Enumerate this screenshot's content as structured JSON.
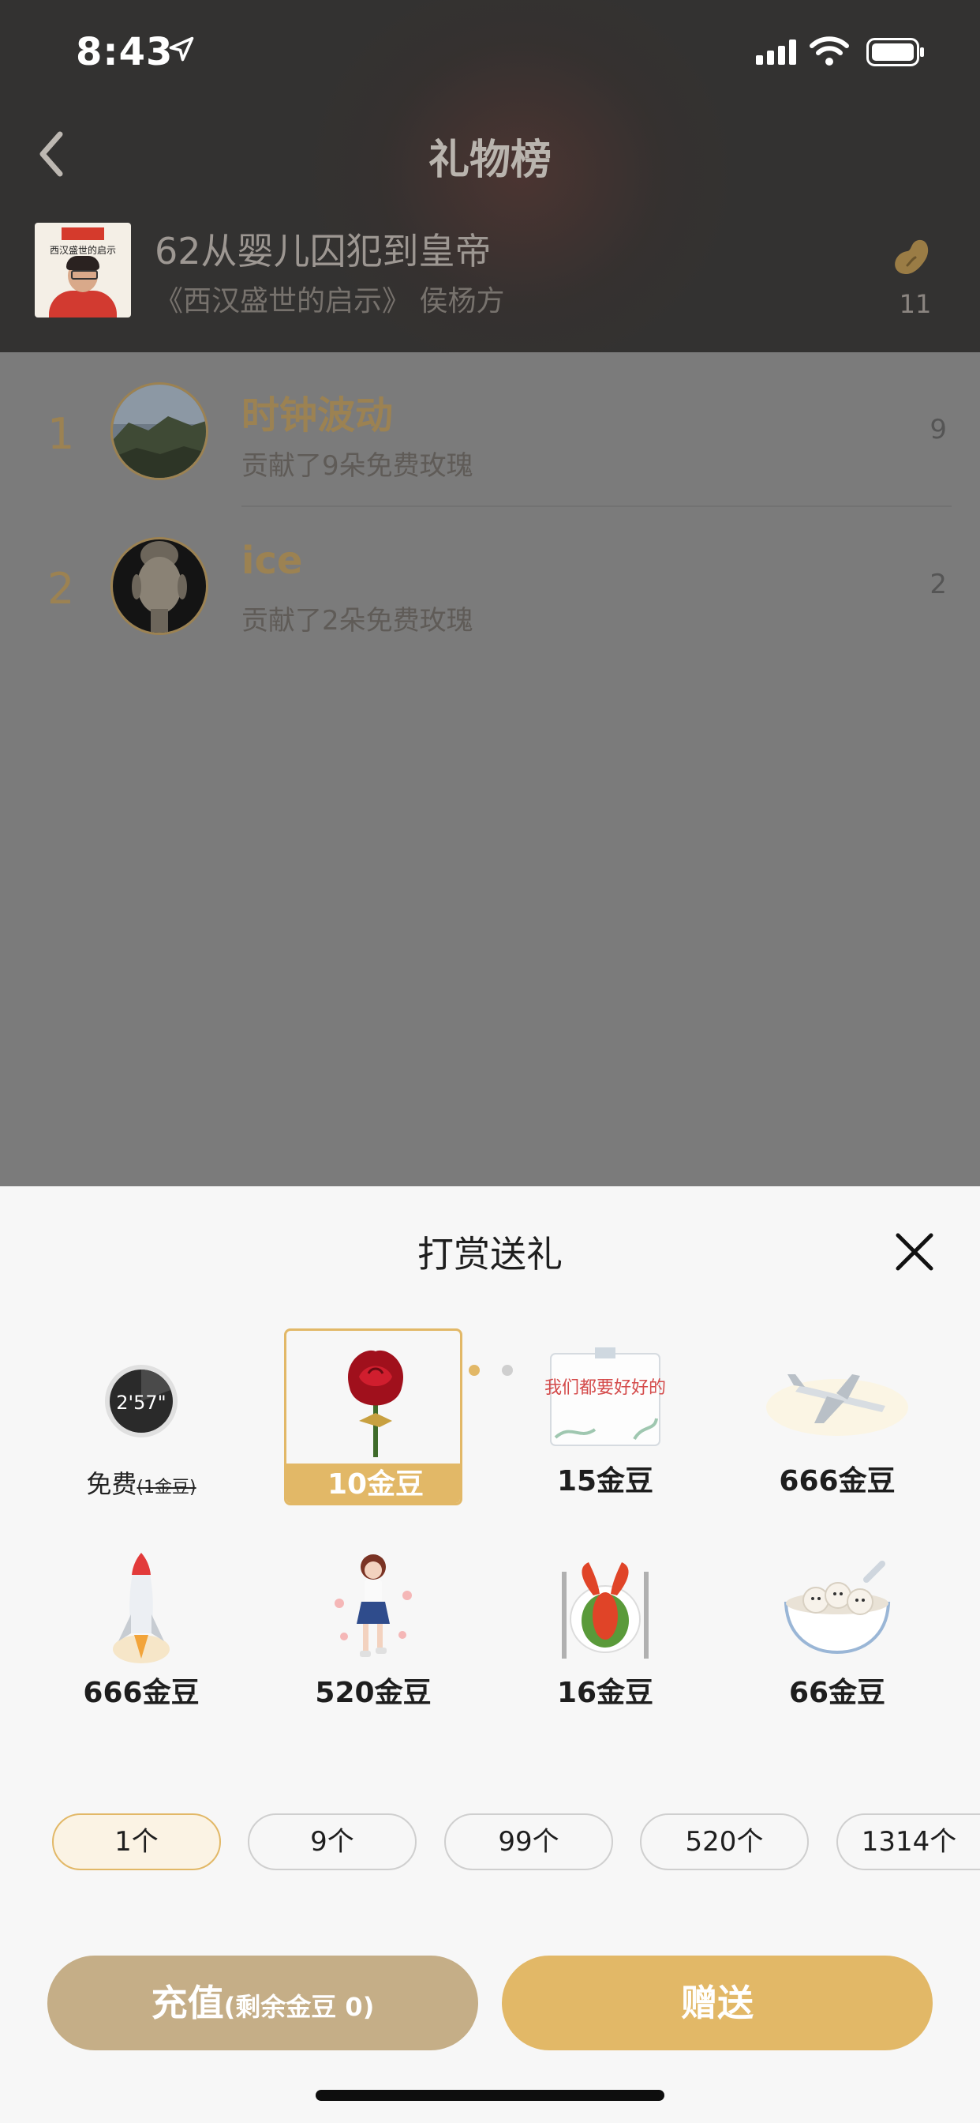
{
  "status_bar": {
    "time": "8:43"
  },
  "header": {
    "title": "礼物榜",
    "episode_title": "62从婴儿囚犯到皇帝",
    "episode_subtitle": "《西汉盛世的启示》 侯杨方",
    "cover_badge": "历史学堂",
    "cover_title": "西汉盛世的启示",
    "bean_count": "11"
  },
  "ranking": [
    {
      "rank": "1",
      "name": "时钟波动",
      "desc": "贡献了9朵免费玫瑰",
      "score": "9"
    },
    {
      "rank": "2",
      "name": "ice",
      "desc": "贡献了2朵免费玫瑰",
      "score": "2"
    }
  ],
  "gift_sheet": {
    "title": "打赏送礼",
    "timer": "2'57\"",
    "free_label": "免费",
    "free_strike": "(1金豆)",
    "gifts": [
      {
        "label": "10金豆",
        "icon": "rose-icon",
        "selected": true
      },
      {
        "label": "15金豆",
        "icon": "card-icon",
        "card_text": "我们都要好好的"
      },
      {
        "label": "666金豆",
        "icon": "airplane-icon"
      },
      {
        "label": "666金豆",
        "icon": "rocket-icon"
      },
      {
        "label": "520金豆",
        "icon": "girl-icon"
      },
      {
        "label": "16金豆",
        "icon": "lobster-icon"
      },
      {
        "label": "66金豆",
        "icon": "dumplings-icon"
      }
    ],
    "quantities": [
      "1个",
      "9个",
      "99个",
      "520个",
      "1314个"
    ],
    "recharge_label": "充值",
    "recharge_balance": "(剩余金豆 0)",
    "send_label": "赠送"
  },
  "colors": {
    "accent": "#e2b867",
    "recharge": "#c5ae87"
  }
}
